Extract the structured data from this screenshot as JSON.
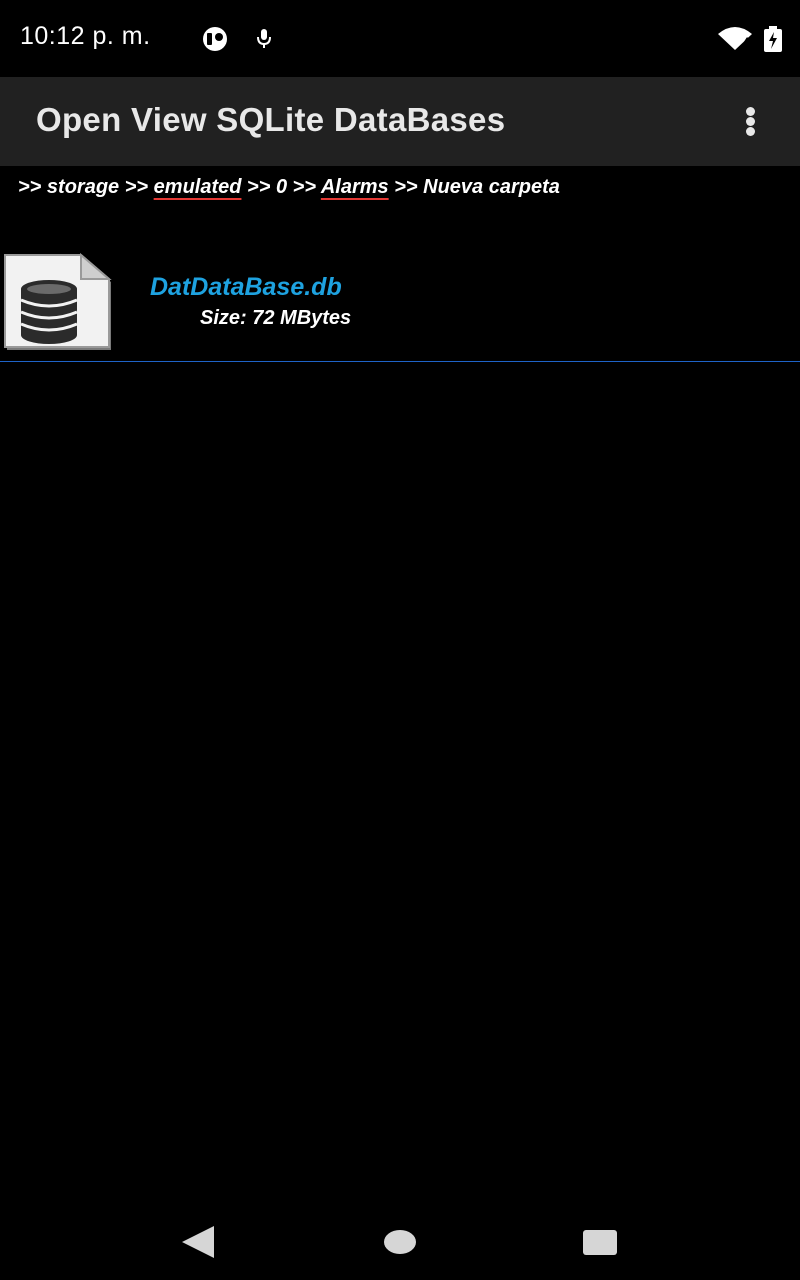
{
  "status_bar": {
    "time": "10:12 p. m.",
    "icons": [
      "notification-app-icon",
      "microphone-icon",
      "wifi-icon",
      "battery-charging-icon"
    ],
    "wifi_badge": "4"
  },
  "app_bar": {
    "title": "Open View SQLite DataBases",
    "menu_icon": "overflow-menu-icon"
  },
  "breadcrumb": {
    "separator": ">>",
    "items": [
      "storage",
      "emulated",
      "0",
      "Alarms",
      "Nueva carpeta"
    ]
  },
  "files": [
    {
      "icon": "database-file-icon",
      "name": "DatDataBase.db",
      "size": "Size: 72 MBytes"
    }
  ],
  "nav_bar": {
    "icons": [
      "back-icon",
      "home-icon",
      "recents-icon"
    ]
  },
  "colors": {
    "background": "#000000",
    "app_bar": "#212121",
    "file_name": "#1ea2e0",
    "divider": "#1e63c8",
    "spell_underline": "#e53935"
  }
}
